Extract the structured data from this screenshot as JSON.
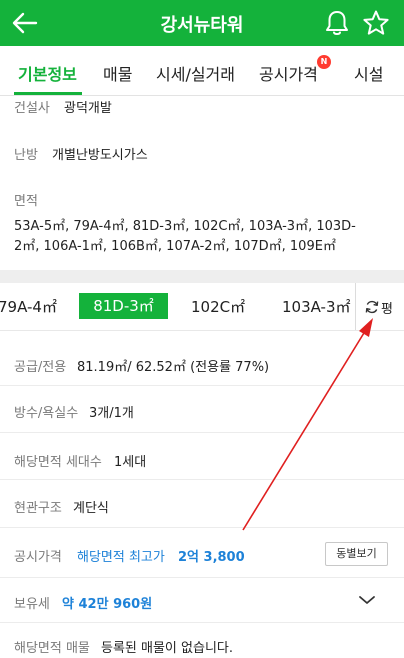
{
  "header": {
    "title": "강서뉴타워",
    "bg_color": "#14b23b"
  },
  "tabs": [
    {
      "label": "기본정보",
      "active": true
    },
    {
      "label": "매물"
    },
    {
      "label": "시세/실거래"
    },
    {
      "label": "공시가격",
      "badge": "N"
    },
    {
      "label": "시설"
    }
  ],
  "info": {
    "builder_label": "건설사",
    "builder_value": "광덕개발",
    "heating_label": "난방",
    "heating_value": "개별난방도시가스",
    "area_label": "면적",
    "area_line1": "53A-5㎡, 79A-4㎡, 81D-3㎡, 102C㎡, 103A-3㎡, 103D-",
    "area_line2": "2㎡, 106A-1㎡, 106B㎡, 107A-2㎡, 107D㎡, 109E㎡"
  },
  "area_chips": {
    "items": [
      "79A-4㎡",
      "81D-3㎡",
      "102C㎡",
      "103A-3㎡"
    ],
    "selected": "81D-3㎡",
    "unit_toggle": "평"
  },
  "detail": {
    "supply_label": "공급/전용",
    "supply_value": "81.19㎡/ 62.52㎡ (전용률 77%)",
    "rooms_label": "방수/욕실수",
    "rooms_value": "3개/1개",
    "households_label": "해당면적 세대수",
    "households_value": "1세대",
    "entrance_label": "현관구조",
    "entrance_value": "계단식",
    "official_label": "공시가격",
    "official_prefix": "해당면적 최고가",
    "official_value": "2억 3,800",
    "official_button": "동별보기",
    "tax_label": "보유세",
    "tax_value": "약 42만 960원",
    "listing_label": "해당면적 매물",
    "listing_value": "등록된 매물이 없습니다."
  },
  "colors": {
    "accent": "#14b23b",
    "link_blue": "#1e82d8",
    "annotation_red": "#e02020"
  },
  "icons": [
    "back-arrow-icon",
    "bell-icon",
    "star-icon",
    "refresh-icon",
    "chevron-down-icon"
  ]
}
